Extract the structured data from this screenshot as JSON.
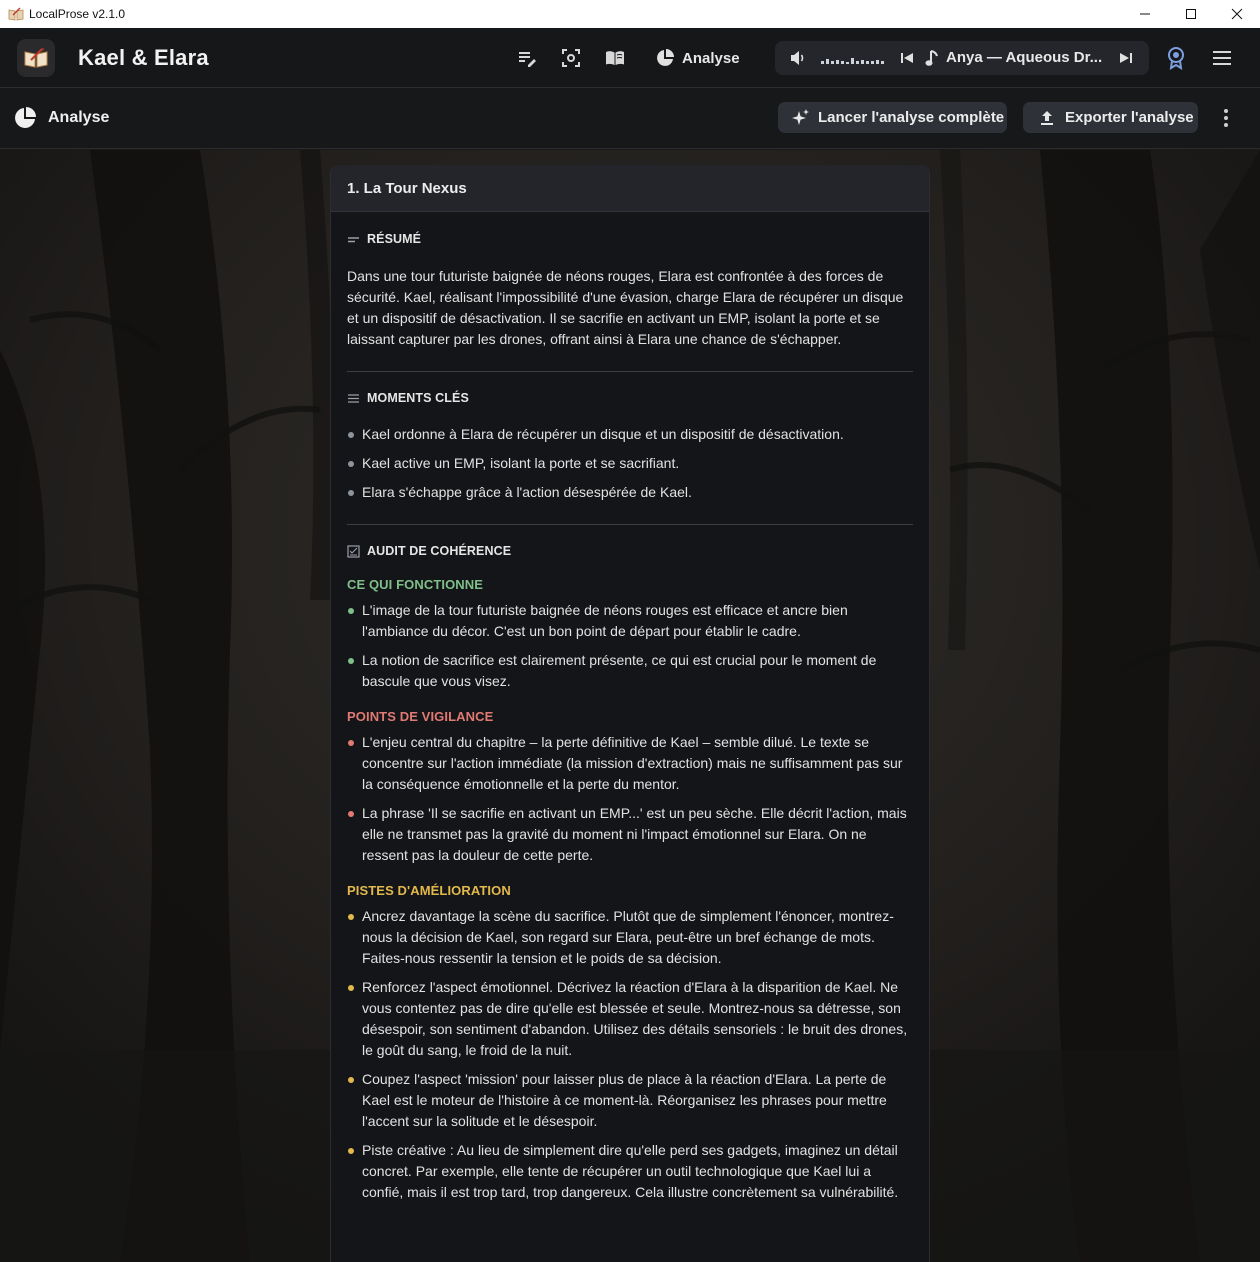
{
  "window": {
    "title": "LocalProse v2.1.0"
  },
  "header": {
    "project_title": "Kael & Elara",
    "analyse_tab_label": "Analyse",
    "player": {
      "track": "Anya — Aqueous Dr..."
    }
  },
  "toolbar": {
    "title": "Analyse",
    "run_label": "Lancer l'analyse complète",
    "export_label": "Exporter l'analyse"
  },
  "chapter": {
    "title": "1. La Tour Nexus",
    "summary_heading": "RÉSUMÉ",
    "summary": "Dans une tour futuriste baignée de néons rouges, Elara est confrontée à des forces de sécurité. Kael, réalisant l'impossibilité d'une évasion, charge Elara de récupérer un disque et un dispositif de désactivation. Il se sacrifie en activant un EMP, isolant la porte et se laissant capturer par les drones, offrant ainsi à Elara une chance de s'échapper.",
    "moments_heading": "MOMENTS CLÉS",
    "moments": [
      "Kael ordonne à Elara de récupérer un disque et un dispositif de désactivation.",
      "Kael active un EMP, isolant la porte et se sacrifiant.",
      "Elara s'échappe grâce à l'action désespérée de Kael."
    ],
    "audit_heading": "AUDIT DE COHÉRENCE",
    "works_heading": "CE QUI FONCTIONNE",
    "works": [
      "L'image de la tour futuriste baignée de néons rouges est efficace et ancre bien l'ambiance du décor. C'est un bon point de départ pour établir le cadre.",
      "La notion de sacrifice est clairement présente, ce qui est crucial pour le moment de bascule que vous visez."
    ],
    "vigilance_heading": "POINTS DE VIGILANCE",
    "vigilance": [
      "L'enjeu central du chapitre – la perte définitive de Kael – semble dilué. Le texte se concentre sur l'action immédiate (la mission d'extraction) mais ne suffisamment pas sur la conséquence émotionnelle et la perte du mentor.",
      "La phrase 'Il se sacrifie en activant un EMP...' est un peu sèche. Elle décrit l'action, mais elle ne transmet pas la gravité du moment ni l'impact émotionnel sur Elara. On ne ressent pas la douleur de cette perte."
    ],
    "improve_heading": "PISTES D'AMÉLIORATION",
    "improve": [
      "Ancrez davantage la scène du sacrifice. Plutôt que de simplement l'énoncer, montrez-nous la décision de Kael, son regard sur Elara, peut-être un bref échange de mots. Faites-nous ressentir la tension et le poids de sa décision.",
      "Renforcez l'aspect émotionnel.  Décrivez la réaction d'Elara à la disparition de Kael. Ne vous contentez pas de dire qu'elle est blessée et seule.  Montrez-nous sa détresse, son désespoir, son sentiment d'abandon.  Utilisez des détails sensoriels : le bruit des drones, le goût du sang, le froid de la nuit.",
      "Coupez l'aspect 'mission' pour laisser plus de place à la réaction d'Elara.  La perte de Kael est le moteur de l'histoire à ce moment-là.  Réorganisez les phrases pour mettre l'accent sur la solitude et le désespoir.",
      "Piste créative :  Au lieu de simplement dire qu'elle perd ses gadgets, imaginez un détail concret.  Par exemple, elle tente de récupérer un outil technologique que Kael lui a confié, mais il est trop tard, trop dangereux.  Cela illustre concrètement sa vulnérabilité."
    ]
  },
  "colors": {
    "works": "#7fc08a",
    "vigilance": "#e07a73",
    "improve": "#e3b94c",
    "neutral_bullet": "#8e939c"
  }
}
